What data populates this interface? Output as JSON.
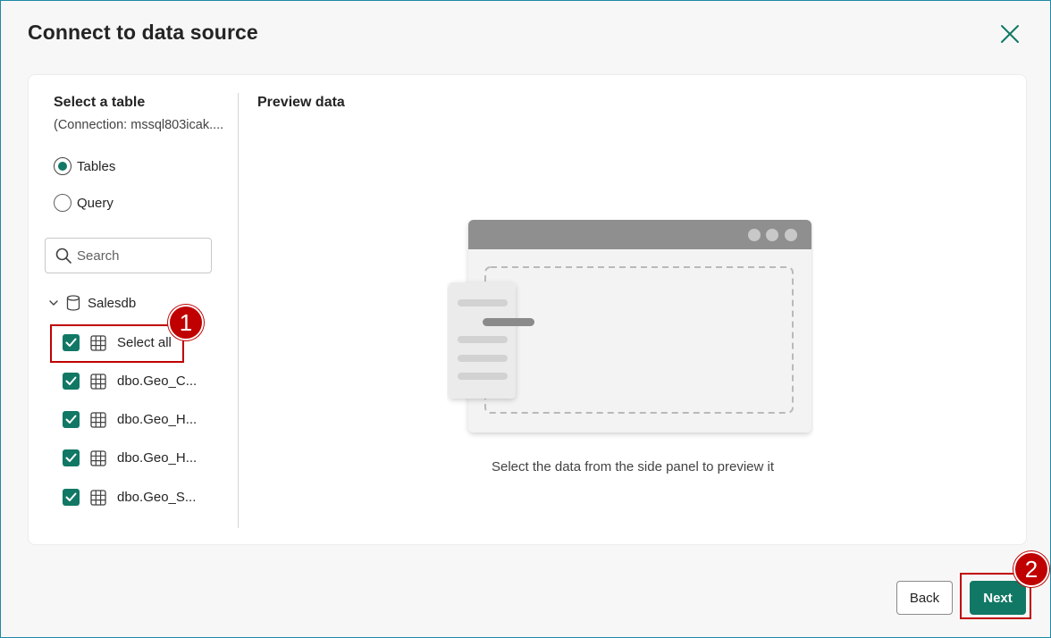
{
  "dialog": {
    "title": "Connect to data source",
    "close_icon": "close-icon"
  },
  "left_panel": {
    "heading": "Select a table",
    "connection": "(Connection: mssql803icak....",
    "radio_options": [
      {
        "label": "Tables",
        "checked": true
      },
      {
        "label": "Query",
        "checked": false
      }
    ],
    "search": {
      "placeholder": "Search",
      "value": ""
    },
    "tree": {
      "root_label": "Salesdb",
      "root_icon": "database-icon",
      "items": [
        {
          "label": "Select all",
          "checked": true
        },
        {
          "label": "dbo.Geo_C...",
          "checked": true
        },
        {
          "label": "dbo.Geo_H...",
          "checked": true
        },
        {
          "label": "dbo.Geo_H...",
          "checked": true
        },
        {
          "label": "dbo.Geo_S...",
          "checked": true
        }
      ]
    }
  },
  "preview": {
    "heading": "Preview data",
    "caption": "Select the data from the side panel to preview it"
  },
  "footer": {
    "back_label": "Back",
    "next_label": "Next"
  },
  "annotations": {
    "badge_1": "1",
    "badge_2": "2"
  },
  "colors": {
    "accent": "#117865",
    "annotation_red": "#c00000"
  }
}
